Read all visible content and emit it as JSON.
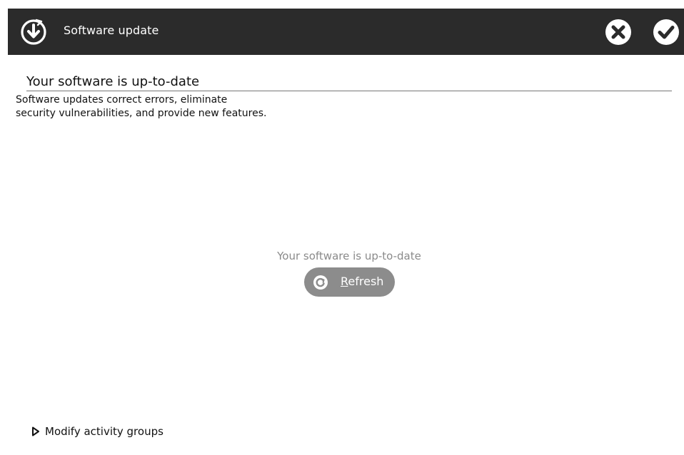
{
  "window": {
    "title": "Software update",
    "icons": {
      "app": "download-update-icon",
      "close": "close-icon",
      "confirm": "checkmark-icon"
    }
  },
  "main": {
    "heading": "Your software is up-to-date",
    "description_line1": "Software updates correct errors, eliminate",
    "description_line2": "security vulnerabilities, and provide new features.",
    "status": "Your software is up-to-date",
    "refresh": {
      "mnemonic": "R",
      "rest": "efresh",
      "icon": "refresh-icon"
    }
  },
  "footer": {
    "expander_label": "Modify activity groups",
    "expander_icon": "triangle-right-icon"
  },
  "colors": {
    "titlebar": "#2b2b2b",
    "button": "#8c8c8c",
    "status_text": "#8a8a8a"
  }
}
